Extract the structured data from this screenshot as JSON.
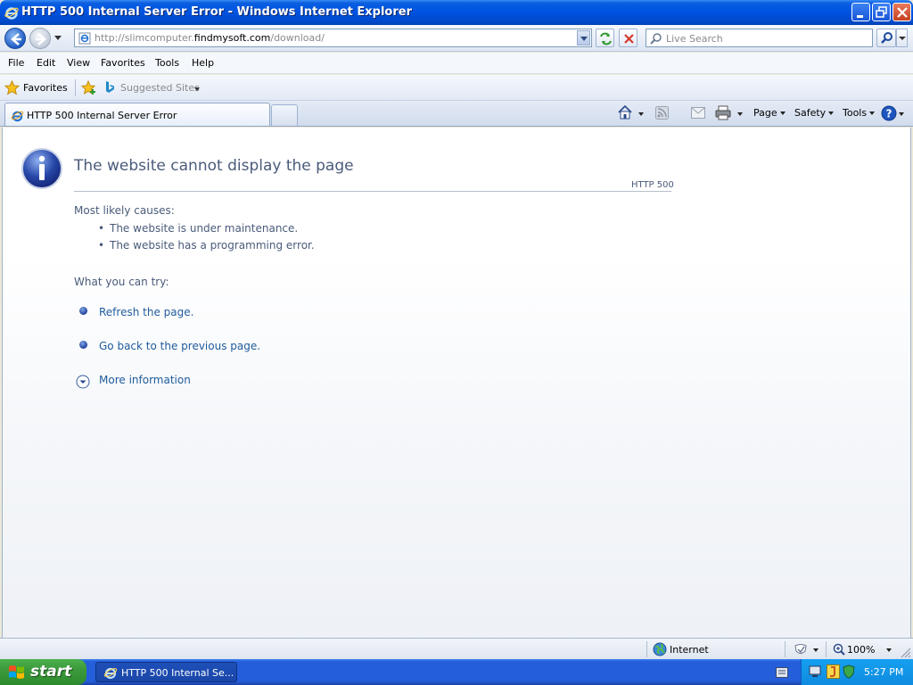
{
  "window": {
    "title": "HTTP 500 Internal Server Error - Windows Internet Explorer"
  },
  "address": {
    "url_prefix": "http://slimcomputer.",
    "url_domain": "findmysoft.com",
    "url_suffix": "/download/"
  },
  "search": {
    "placeholder": "Live Search"
  },
  "menu": [
    "File",
    "Edit",
    "View",
    "Favorites",
    "Tools",
    "Help"
  ],
  "favorites_bar": {
    "favorites_label": "Favorites",
    "suggested_sites_label": "Suggested Sites"
  },
  "tabs": {
    "active_label": "HTTP 500 Internal Server Error"
  },
  "command_bar": {
    "page": "Page",
    "safety": "Safety",
    "tools": "Tools"
  },
  "page": {
    "heading": "The website cannot display the page",
    "http_code": "HTTP 500",
    "causes_title": "Most likely causes:",
    "causes": [
      "The website is under maintenance.",
      "The website has a programming error."
    ],
    "try_title": "What you can try:",
    "actions": [
      "Refresh the page.",
      "Go back to the previous page."
    ],
    "more_info": "More information"
  },
  "status": {
    "zone": "Internet",
    "zoom": "100%"
  },
  "taskbar": {
    "start": "start",
    "task_label": "HTTP 500 Internal Se...",
    "clock": "5:27 PM"
  },
  "colors": {
    "title_bar": "#0054e3",
    "link": "#1f5b9c",
    "heading_text": "#4a5b7a",
    "start_button": "#3c9a3c",
    "taskbar": "#245edb"
  }
}
